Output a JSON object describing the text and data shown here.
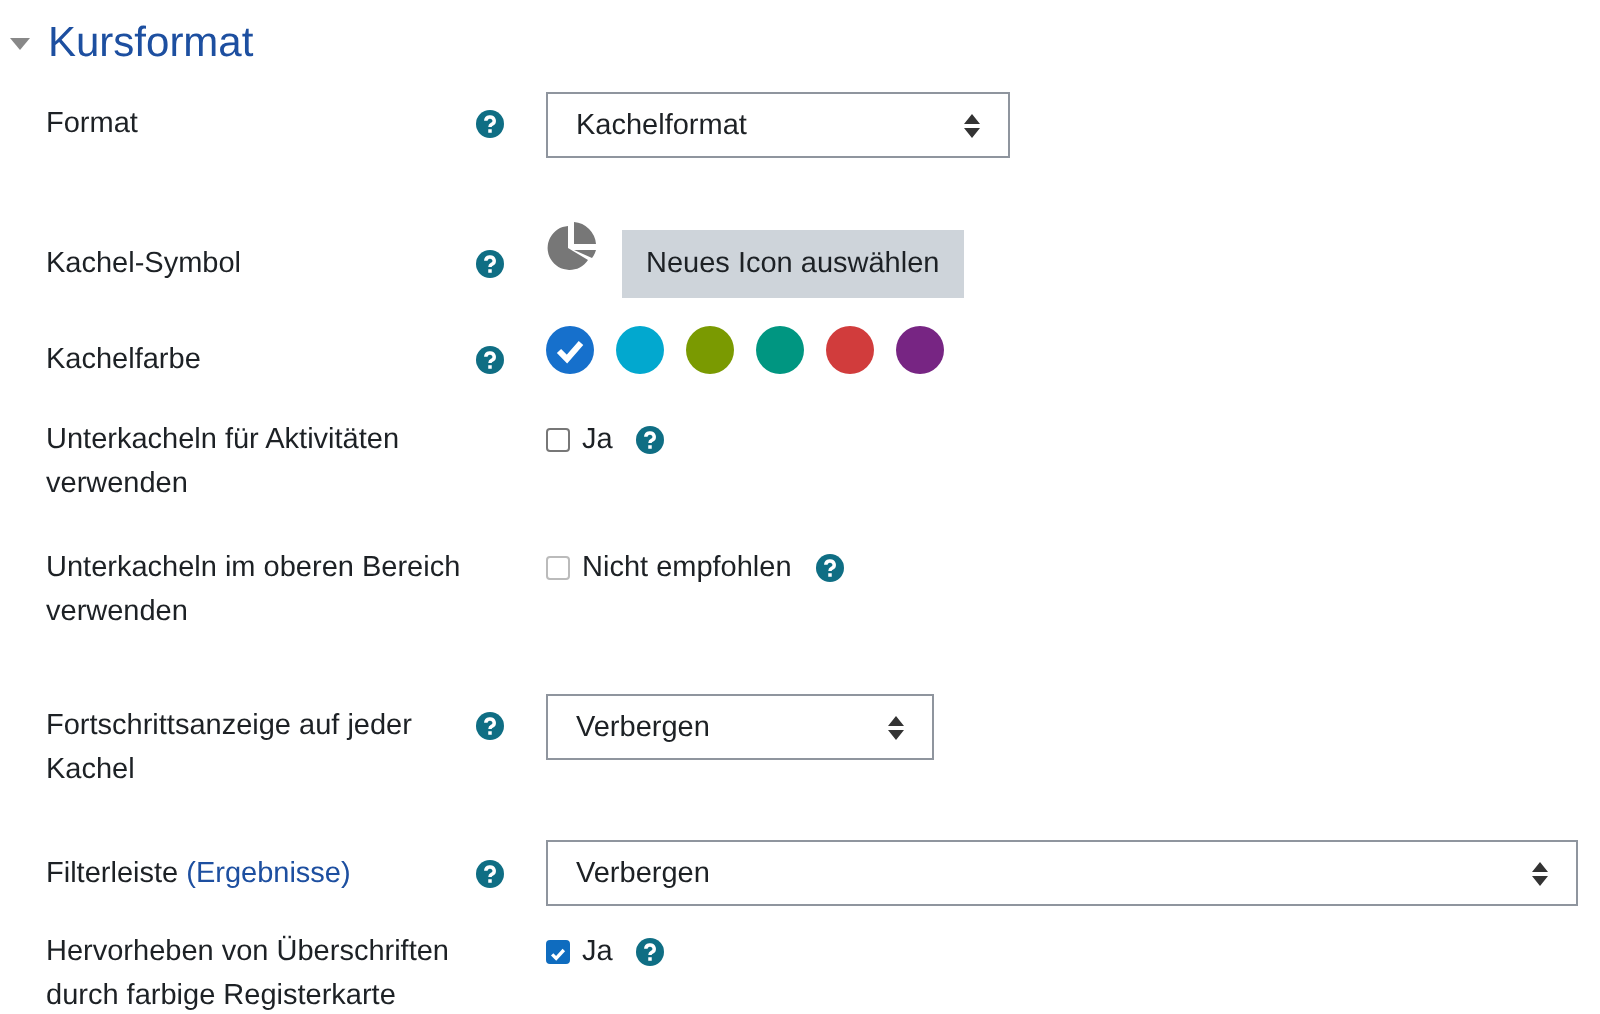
{
  "section": {
    "title": "Kursformat"
  },
  "rows": [
    {
      "kind": "select",
      "label": "Format",
      "value": "Kachelformat"
    },
    {
      "kind": "icon",
      "label": "Kachel-Symbol",
      "button": "Neues Icon auswählen"
    },
    {
      "kind": "colors",
      "label": "Kachelfarbe",
      "colors": [
        {
          "color": "#1670cc",
          "selected": true
        },
        {
          "color": "#02a8cf",
          "selected": false
        },
        {
          "color": "#7a9a01",
          "selected": false
        },
        {
          "color": "#009681",
          "selected": false
        },
        {
          "color": "#d13c3c",
          "selected": false
        },
        {
          "color": "#772583",
          "selected": false
        }
      ]
    },
    {
      "kind": "checkbox",
      "label": "Unterkacheln für Aktivitäten verwenden",
      "option": "Ja",
      "checked": false,
      "disabled": false
    },
    {
      "kind": "checkbox",
      "label": "Unterkacheln im oberen Bereich verwenden",
      "option": "Nicht empfohlen",
      "checked": false,
      "disabled": true
    },
    {
      "kind": "select",
      "label": "Fortschrittsanzeige auf jeder Kachel",
      "value": "Verbergen"
    },
    {
      "kind": "select",
      "label": "Filterleiste",
      "link": "(Ergebnisse)",
      "value": "Verbergen"
    },
    {
      "kind": "checkbox",
      "label": "Hervorheben von Überschriften durch farbige Registerkarte",
      "option": "Ja",
      "checked": true,
      "disabled": false
    }
  ]
}
